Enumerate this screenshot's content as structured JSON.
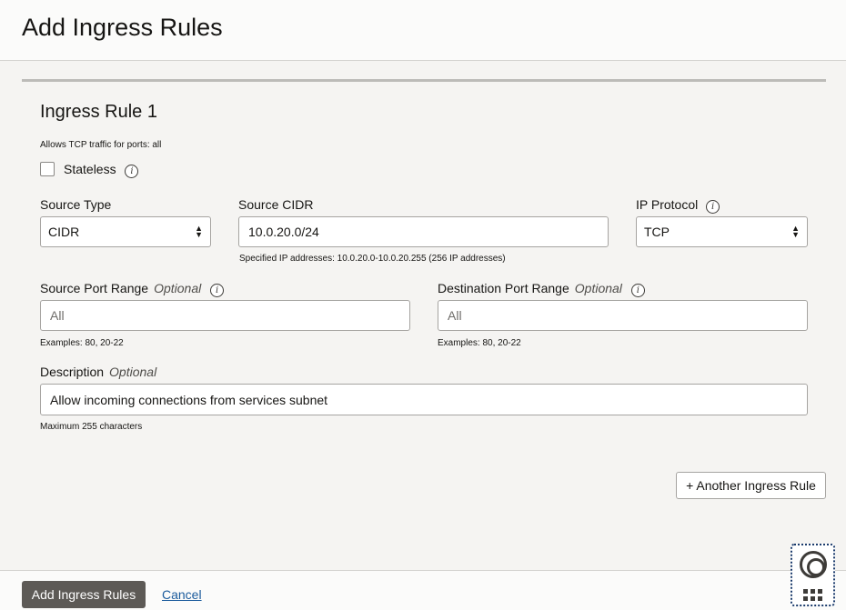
{
  "header": {
    "title": "Add Ingress Rules"
  },
  "rule": {
    "title": "Ingress Rule 1",
    "description": "Allows TCP traffic for ports: all",
    "stateless_label": "Stateless",
    "stateless_checked": false,
    "source_type": {
      "label": "Source Type",
      "value": "CIDR"
    },
    "source_cidr": {
      "label": "Source CIDR",
      "value": "10.0.20.0/24",
      "help": "Specified IP addresses: 10.0.20.0-10.0.20.255 (256 IP addresses)"
    },
    "ip_protocol": {
      "label": "IP Protocol",
      "value": "TCP"
    },
    "source_port": {
      "label": "Source Port Range",
      "optional": "Optional",
      "placeholder": "All",
      "help": "Examples: 80, 20-22"
    },
    "dest_port": {
      "label": "Destination Port Range",
      "optional": "Optional",
      "placeholder": "All",
      "help": "Examples: 80, 20-22"
    },
    "description_field": {
      "label": "Description",
      "optional": "Optional",
      "value": "Allow incoming connections from services subnet",
      "help": "Maximum 255 characters"
    }
  },
  "another_rule_label": "+ Another Ingress Rule",
  "footer": {
    "submit_label": "Add Ingress Rules",
    "cancel_label": "Cancel"
  },
  "icons": {
    "info": "info-icon",
    "help": "lifebuoy-icon",
    "apps": "grid-icon"
  }
}
